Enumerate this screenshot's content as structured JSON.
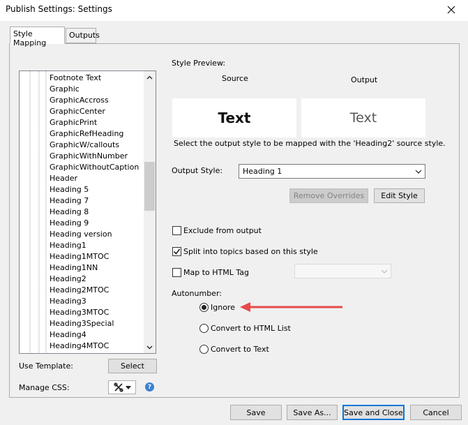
{
  "window": {
    "title": "Publish Settings: Settings"
  },
  "tabs": [
    {
      "label": "Style Mapping"
    },
    {
      "label": "Outputs"
    }
  ],
  "style_list": {
    "items": [
      "Footnote Text",
      "Graphic",
      "GraphicAccross",
      "GraphicCenter",
      "GraphicPrint",
      "GraphicRefHeading",
      "GraphicW/callouts",
      "GraphicWithNumber",
      "GraphicWithoutCaption",
      "Header",
      "Heading 5",
      "Heading 7",
      "Heading 8",
      "Heading 9",
      "Heading version",
      "Heading1",
      "Heading1MTOC",
      "Heading1NN",
      "Heading2",
      "Heading2MTOC",
      "Heading3",
      "Heading3MTOC",
      "Heading3Special",
      "Heading4",
      "Heading4MTOC"
    ]
  },
  "preview": {
    "label": "Style Preview:",
    "source_label": "Source",
    "output_label": "Output",
    "source_text": "Text",
    "output_text": "Text",
    "description": "Select the output style to be mapped with the 'Heading2' source style."
  },
  "output_style": {
    "label": "Output Style:",
    "value": "Heading 1"
  },
  "buttons": {
    "remove_overrides": "Remove Overrides",
    "edit_style": "Edit Style",
    "select": "Select",
    "save": "Save",
    "save_as": "Save As...",
    "save_and_close": "Save and Close",
    "cancel": "Cancel"
  },
  "options": {
    "exclude_label": "Exclude from output",
    "exclude_checked": false,
    "split_label": "Split into topics based on this style",
    "split_checked": true,
    "map_html_label": "Map to HTML Tag",
    "map_html_checked": false,
    "map_html_value": ""
  },
  "autonumber": {
    "label": "Autonumber:",
    "options": [
      "Ignore",
      "Convert to HTML List",
      "Convert to Text"
    ],
    "selected": "Ignore"
  },
  "template": {
    "label": "Use Template:"
  },
  "css": {
    "label": "Manage CSS:"
  },
  "colors": {
    "accent": "#0078d7",
    "annotation_arrow": "#e84a4a"
  },
  "icons": {
    "close": "close-icon",
    "up": "chevron-up-icon",
    "down": "chevron-down-icon",
    "tools": "tools-icon",
    "help": "help-icon"
  }
}
